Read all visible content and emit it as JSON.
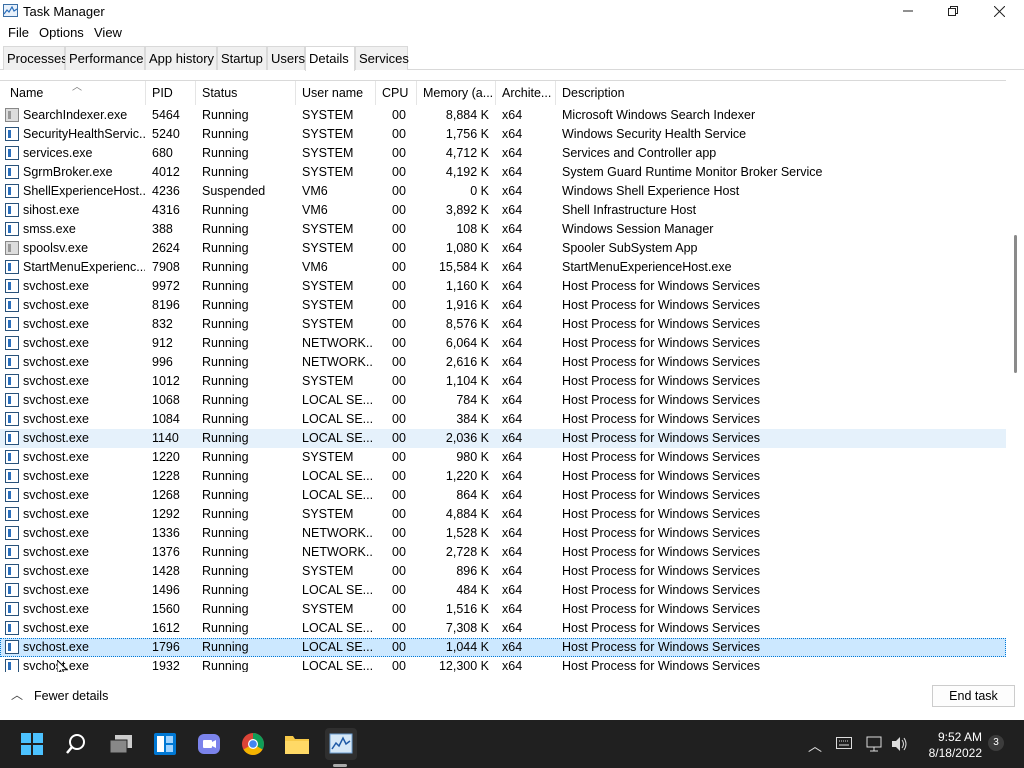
{
  "window": {
    "title": "Task Manager",
    "minimize_icon": "minimize-icon",
    "maximize_icon": "maximize-icon",
    "close_icon": "close-icon"
  },
  "menu": [
    "File",
    "Options",
    "View"
  ],
  "tabs": [
    "Processes",
    "Performance",
    "App history",
    "Startup",
    "Users",
    "Details",
    "Services"
  ],
  "active_tab": "Details",
  "columns": [
    "Name",
    "PID",
    "Status",
    "User name",
    "CPU",
    "Memory (a...",
    "Archite...",
    "Description"
  ],
  "rows": [
    {
      "name": "SearchIndexer.exe",
      "pid": "5464",
      "status": "Running",
      "user": "SYSTEM",
      "cpu": "00",
      "mem": "8,884 K",
      "arch": "x64",
      "desc": "Microsoft Windows Search Indexer",
      "icon": "search-indexer-icon"
    },
    {
      "name": "SecurityHealthServic...",
      "pid": "5240",
      "status": "Running",
      "user": "SYSTEM",
      "cpu": "00",
      "mem": "1,756 K",
      "arch": "x64",
      "desc": "Windows Security Health Service",
      "icon": "process-icon"
    },
    {
      "name": "services.exe",
      "pid": "680",
      "status": "Running",
      "user": "SYSTEM",
      "cpu": "00",
      "mem": "4,712 K",
      "arch": "x64",
      "desc": "Services and Controller app",
      "icon": "process-icon"
    },
    {
      "name": "SgrmBroker.exe",
      "pid": "4012",
      "status": "Running",
      "user": "SYSTEM",
      "cpu": "00",
      "mem": "4,192 K",
      "arch": "x64",
      "desc": "System Guard Runtime Monitor Broker Service",
      "icon": "process-icon"
    },
    {
      "name": "ShellExperienceHost....",
      "pid": "4236",
      "status": "Suspended",
      "user": "VM6",
      "cpu": "00",
      "mem": "0 K",
      "arch": "x64",
      "desc": "Windows Shell Experience Host",
      "icon": "process-icon"
    },
    {
      "name": "sihost.exe",
      "pid": "4316",
      "status": "Running",
      "user": "VM6",
      "cpu": "00",
      "mem": "3,892 K",
      "arch": "x64",
      "desc": "Shell Infrastructure Host",
      "icon": "process-icon"
    },
    {
      "name": "smss.exe",
      "pid": "388",
      "status": "Running",
      "user": "SYSTEM",
      "cpu": "00",
      "mem": "108 K",
      "arch": "x64",
      "desc": "Windows Session Manager",
      "icon": "process-icon"
    },
    {
      "name": "spoolsv.exe",
      "pid": "2624",
      "status": "Running",
      "user": "SYSTEM",
      "cpu": "00",
      "mem": "1,080 K",
      "arch": "x64",
      "desc": "Spooler SubSystem App",
      "icon": "printer-icon"
    },
    {
      "name": "StartMenuExperienc...",
      "pid": "7908",
      "status": "Running",
      "user": "VM6",
      "cpu": "00",
      "mem": "15,584 K",
      "arch": "x64",
      "desc": "StartMenuExperienceHost.exe",
      "icon": "process-icon"
    },
    {
      "name": "svchost.exe",
      "pid": "9972",
      "status": "Running",
      "user": "SYSTEM",
      "cpu": "00",
      "mem": "1,160 K",
      "arch": "x64",
      "desc": "Host Process for Windows Services",
      "icon": "process-icon"
    },
    {
      "name": "svchost.exe",
      "pid": "8196",
      "status": "Running",
      "user": "SYSTEM",
      "cpu": "00",
      "mem": "1,916 K",
      "arch": "x64",
      "desc": "Host Process for Windows Services",
      "icon": "process-icon"
    },
    {
      "name": "svchost.exe",
      "pid": "832",
      "status": "Running",
      "user": "SYSTEM",
      "cpu": "00",
      "mem": "8,576 K",
      "arch": "x64",
      "desc": "Host Process for Windows Services",
      "icon": "process-icon"
    },
    {
      "name": "svchost.exe",
      "pid": "912",
      "status": "Running",
      "user": "NETWORK...",
      "cpu": "00",
      "mem": "6,064 K",
      "arch": "x64",
      "desc": "Host Process for Windows Services",
      "icon": "process-icon"
    },
    {
      "name": "svchost.exe",
      "pid": "996",
      "status": "Running",
      "user": "NETWORK...",
      "cpu": "00",
      "mem": "2,616 K",
      "arch": "x64",
      "desc": "Host Process for Windows Services",
      "icon": "process-icon"
    },
    {
      "name": "svchost.exe",
      "pid": "1012",
      "status": "Running",
      "user": "SYSTEM",
      "cpu": "00",
      "mem": "1,104 K",
      "arch": "x64",
      "desc": "Host Process for Windows Services",
      "icon": "process-icon"
    },
    {
      "name": "svchost.exe",
      "pid": "1068",
      "status": "Running",
      "user": "LOCAL SE...",
      "cpu": "00",
      "mem": "784 K",
      "arch": "x64",
      "desc": "Host Process for Windows Services",
      "icon": "process-icon"
    },
    {
      "name": "svchost.exe",
      "pid": "1084",
      "status": "Running",
      "user": "LOCAL SE...",
      "cpu": "00",
      "mem": "384 K",
      "arch": "x64",
      "desc": "Host Process for Windows Services",
      "icon": "process-icon"
    },
    {
      "name": "svchost.exe",
      "pid": "1140",
      "status": "Running",
      "user": "LOCAL SE...",
      "cpu": "00",
      "mem": "2,036 K",
      "arch": "x64",
      "desc": "Host Process for Windows Services",
      "icon": "process-icon",
      "state": "hover"
    },
    {
      "name": "svchost.exe",
      "pid": "1220",
      "status": "Running",
      "user": "SYSTEM",
      "cpu": "00",
      "mem": "980 K",
      "arch": "x64",
      "desc": "Host Process for Windows Services",
      "icon": "process-icon"
    },
    {
      "name": "svchost.exe",
      "pid": "1228",
      "status": "Running",
      "user": "LOCAL SE...",
      "cpu": "00",
      "mem": "1,220 K",
      "arch": "x64",
      "desc": "Host Process for Windows Services",
      "icon": "process-icon"
    },
    {
      "name": "svchost.exe",
      "pid": "1268",
      "status": "Running",
      "user": "LOCAL SE...",
      "cpu": "00",
      "mem": "864 K",
      "arch": "x64",
      "desc": "Host Process for Windows Services",
      "icon": "process-icon"
    },
    {
      "name": "svchost.exe",
      "pid": "1292",
      "status": "Running",
      "user": "SYSTEM",
      "cpu": "00",
      "mem": "4,884 K",
      "arch": "x64",
      "desc": "Host Process for Windows Services",
      "icon": "process-icon"
    },
    {
      "name": "svchost.exe",
      "pid": "1336",
      "status": "Running",
      "user": "NETWORK...",
      "cpu": "00",
      "mem": "1,528 K",
      "arch": "x64",
      "desc": "Host Process for Windows Services",
      "icon": "process-icon"
    },
    {
      "name": "svchost.exe",
      "pid": "1376",
      "status": "Running",
      "user": "NETWORK...",
      "cpu": "00",
      "mem": "2,728 K",
      "arch": "x64",
      "desc": "Host Process for Windows Services",
      "icon": "process-icon"
    },
    {
      "name": "svchost.exe",
      "pid": "1428",
      "status": "Running",
      "user": "SYSTEM",
      "cpu": "00",
      "mem": "896 K",
      "arch": "x64",
      "desc": "Host Process for Windows Services",
      "icon": "process-icon"
    },
    {
      "name": "svchost.exe",
      "pid": "1496",
      "status": "Running",
      "user": "LOCAL SE...",
      "cpu": "00",
      "mem": "484 K",
      "arch": "x64",
      "desc": "Host Process for Windows Services",
      "icon": "process-icon"
    },
    {
      "name": "svchost.exe",
      "pid": "1560",
      "status": "Running",
      "user": "SYSTEM",
      "cpu": "00",
      "mem": "1,516 K",
      "arch": "x64",
      "desc": "Host Process for Windows Services",
      "icon": "process-icon"
    },
    {
      "name": "svchost.exe",
      "pid": "1612",
      "status": "Running",
      "user": "LOCAL SE...",
      "cpu": "00",
      "mem": "7,308 K",
      "arch": "x64",
      "desc": "Host Process for Windows Services",
      "icon": "process-icon"
    },
    {
      "name": "svchost.exe",
      "pid": "1796",
      "status": "Running",
      "user": "LOCAL SE...",
      "cpu": "00",
      "mem": "1,044 K",
      "arch": "x64",
      "desc": "Host Process for Windows Services",
      "icon": "process-icon",
      "state": "selected"
    },
    {
      "name": "svchost.exe",
      "pid": "1932",
      "status": "Running",
      "user": "LOCAL SE...",
      "cpu": "00",
      "mem": "12,300 K",
      "arch": "x64",
      "desc": "Host Process for Windows Services",
      "icon": "process-icon"
    }
  ],
  "footer": {
    "fewer_details": "Fewer details",
    "end_task": "End task"
  },
  "taskbar": {
    "icons": [
      "windows-start-icon",
      "search-icon",
      "task-view-icon",
      "widgets-icon",
      "teams-chat-icon",
      "chrome-icon",
      "file-explorer-icon",
      "task-manager-icon"
    ],
    "tray_icons": [
      "chevron-up-icon",
      "keyboard-icon",
      "network-icon",
      "volume-icon"
    ],
    "time": "9:52 AM",
    "date": "8/18/2022",
    "notification_count": "3"
  },
  "colors": {
    "selected_row": "#cce8ff",
    "hover_row": "#e5f1fb",
    "taskbar": "#202020"
  }
}
